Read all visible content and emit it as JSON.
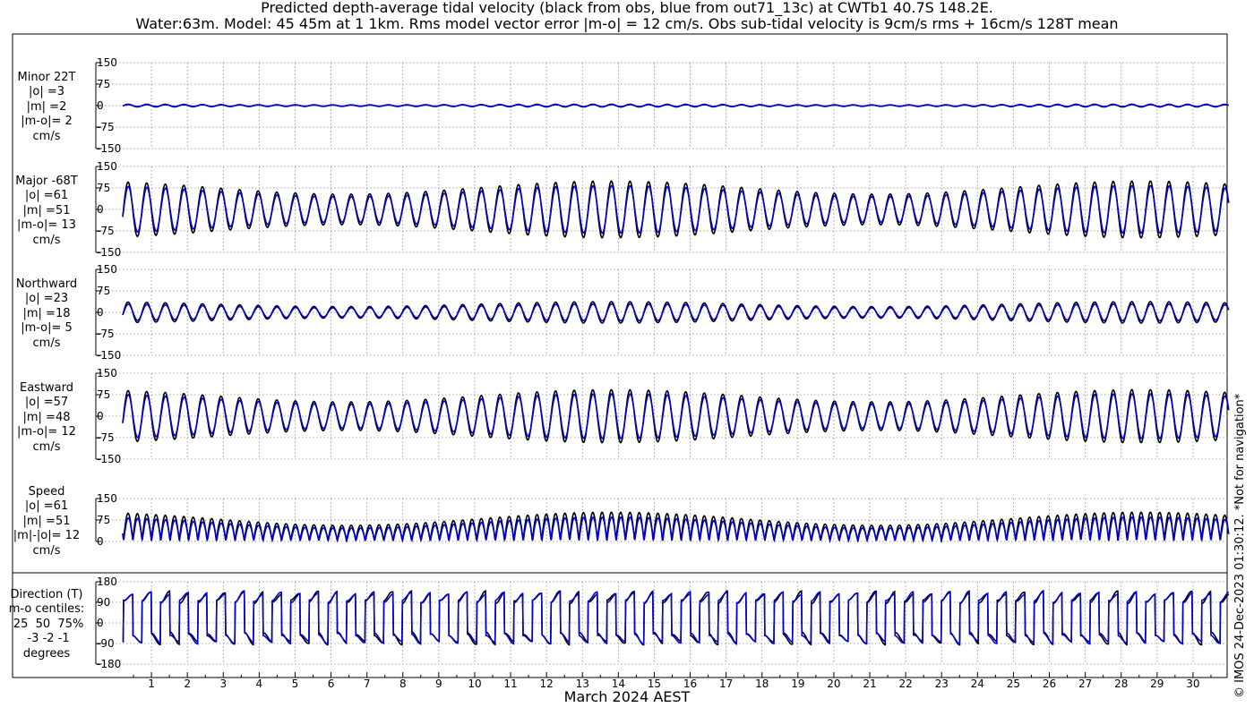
{
  "title": {
    "line1": "Predicted depth-average tidal velocity (black from obs, blue from out71_13c) at CWTb1 40.7S 148.2E.",
    "line2": "Water:63m. Model: 45 45m at 1 1km. Rms model vector error |m-o| = 12 cm/s. Obs sub-tidal velocity is 9cm/s rms + 16cm/s 128T mean"
  },
  "watermark": "© IMOS 24-Dec-2023 01:30:12. *Not for navigation*",
  "colors": {
    "obs": "#000000",
    "model": "#0000dd",
    "grid": "#888888"
  },
  "chart_data": {
    "type": "line",
    "xlabel": "March 2024 AEST",
    "x_ticks": [
      "1",
      "2",
      "3",
      "4",
      "5",
      "6",
      "7",
      "8",
      "9",
      "10",
      "11",
      "12",
      "13",
      "14",
      "15",
      "16",
      "17",
      "18",
      "19",
      "20",
      "21",
      "22",
      "23",
      "24",
      "25",
      "26",
      "27",
      "28",
      "29",
      "30"
    ],
    "x_range_days": [
      0.2,
      31.0
    ],
    "panels": [
      {
        "name": "minor",
        "label": [
          "Minor 22T",
          "|o| =3",
          "|m| =2",
          "|m-o|= 2",
          "cm/s"
        ],
        "ylim": [
          -150,
          150
        ],
        "yticks": [
          "150",
          "75",
          "0",
          "-75",
          "-150"
        ],
        "ytick_values": [
          150,
          75,
          0,
          -75,
          -150
        ],
        "amp_obs": 3,
        "amp_model": 2
      },
      {
        "name": "major",
        "label": [
          "Major -68T",
          "|o| =61",
          "|m| =51",
          "|m-o|= 13",
          "cm/s"
        ],
        "ylim": [
          -150,
          150
        ],
        "yticks": [
          "150",
          "75",
          "0",
          "-75",
          "-150"
        ],
        "ytick_values": [
          150,
          75,
          0,
          -75,
          -150
        ],
        "amp_obs": 61,
        "amp_model": 51
      },
      {
        "name": "northward",
        "label": [
          "Northward",
          "|o| =23",
          "|m| =18",
          "|m-o|= 5",
          "cm/s"
        ],
        "ylim": [
          -150,
          150
        ],
        "yticks": [
          "150",
          "75",
          "0",
          "-75",
          "-150"
        ],
        "ytick_values": [
          150,
          75,
          0,
          -75,
          -150
        ],
        "amp_obs": 23,
        "amp_model": 18
      },
      {
        "name": "eastward",
        "label": [
          "Eastward",
          "|o| =57",
          "|m| =48",
          "|m-o|= 12",
          "cm/s"
        ],
        "ylim": [
          -150,
          150
        ],
        "yticks": [
          "150",
          "75",
          "0",
          "-75",
          "-150"
        ],
        "ytick_values": [
          150,
          75,
          0,
          -75,
          -150
        ],
        "amp_obs": 57,
        "amp_model": 48
      },
      {
        "name": "speed",
        "label": [
          "Speed",
          "|o| =61",
          "|m| =51",
          "|m|-|o|= 12",
          "cm/s"
        ],
        "ylim": [
          0,
          150
        ],
        "yticks": [
          "150",
          "75",
          "0"
        ],
        "ytick_values": [
          150,
          75,
          0
        ],
        "amp_obs": 61,
        "amp_model": 51
      },
      {
        "name": "direction",
        "label": [
          "Direction (T)",
          "m-o centiles:",
          " 25  50  75%",
          " -3 -2 -1",
          "degrees"
        ],
        "ylim": [
          -180,
          180
        ],
        "yticks": [
          "180",
          "90",
          "0",
          "-90",
          "-180"
        ],
        "ytick_values": [
          180,
          90,
          0,
          -90,
          -180
        ],
        "dir_flood": 112,
        "dir_ebb": -68
      }
    ]
  }
}
